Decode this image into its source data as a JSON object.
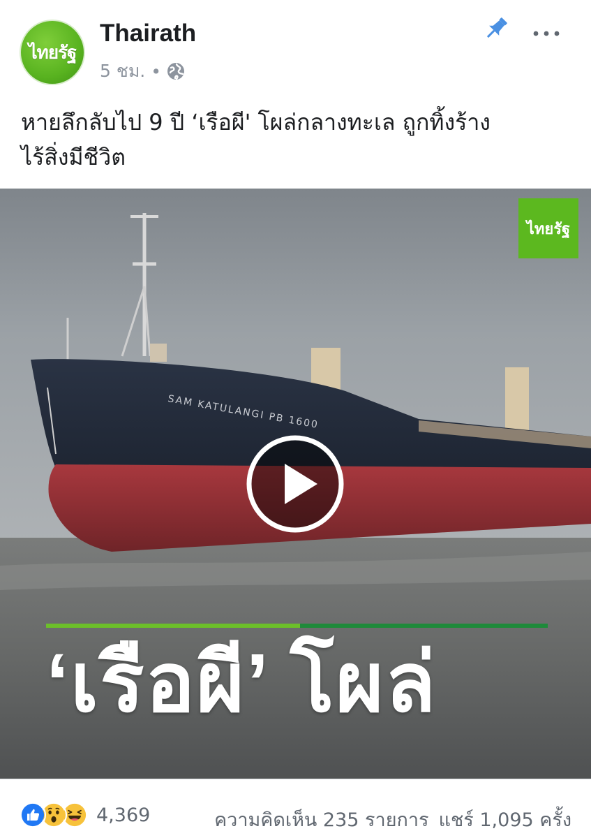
{
  "post": {
    "page_name": "Thairath",
    "time": "5 ชม.",
    "separator": "•",
    "avatar_text": "ไทยรัฐ",
    "text_line1": "หายลึกลับไป 9 ปี ‘เรือผี' โผล่กลางทะเล ถูกทิ้งร้าง",
    "text_line2": "ไร้สิ่งมีชีวิต"
  },
  "video": {
    "logo_text": "ไทยรัฐ",
    "headline": "‘เรือผี’ โผล่",
    "ship_name": "SAM KATULANGI PB 1600"
  },
  "footer": {
    "reaction_count": "4,369",
    "comments": "ความคิดเห็น 235 รายการ",
    "shares": "แชร์ 1,095 ครั้ง"
  },
  "icons": {
    "globe": "globe-icon",
    "pin": "pin-icon",
    "more": "more-icon",
    "play": "play-icon",
    "like": "like-reaction-icon",
    "wow": "wow-reaction-icon",
    "haha": "haha-reaction-icon"
  },
  "colors": {
    "brand_green": "#5cb81f",
    "pin_blue": "#4a90e2",
    "like_blue": "#2078f4",
    "reaction_yellow": "#f7c23b",
    "headline_bar_left": "#6cbf2a",
    "headline_bar_right": "#1e8a3a"
  }
}
